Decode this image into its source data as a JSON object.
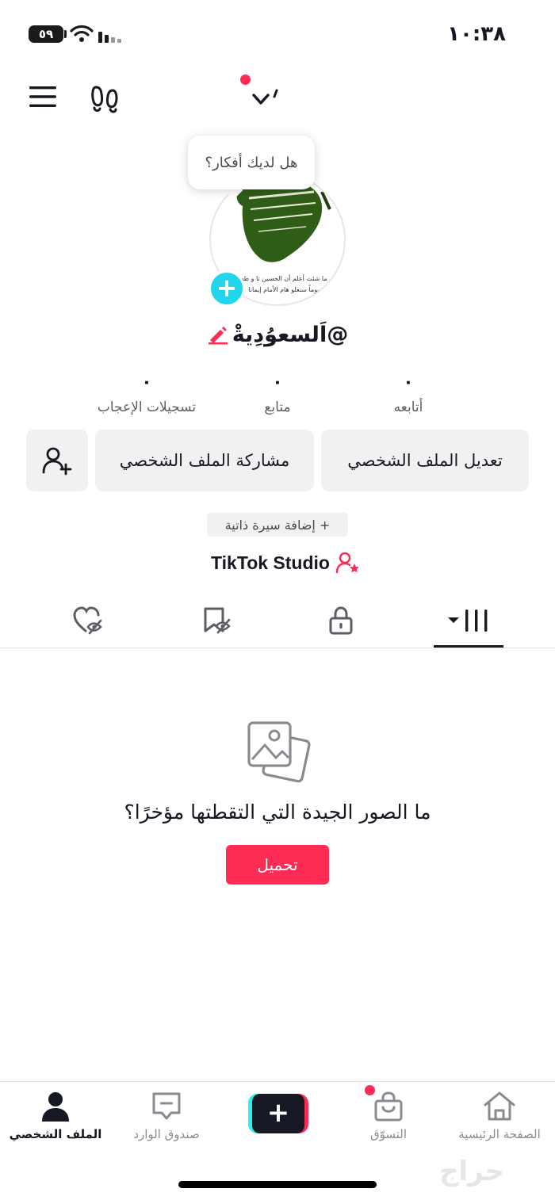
{
  "status_bar": {
    "time": "١٠:٣٨",
    "battery": "٥٩"
  },
  "header": {
    "menu_icon": "hamburger-menu-icon",
    "footprint_icon": "footprints-icon",
    "switch_icon": "chevron-down-icon"
  },
  "profile": {
    "bubble_text": "هل لديك أفكار؟",
    "username": "@اَلسعوُدِيةْ",
    "avatar_caption_line1": "ما شئت أعلم أن الحسين تا و طه",
    "avatar_caption_line2": "يوماً سنعلو هام الأمام إيمانا"
  },
  "stats": [
    {
      "value": "٠",
      "label": "أتابعه"
    },
    {
      "value": "٠",
      "label": "متابع"
    },
    {
      "value": "٠",
      "label": "تسجيلات الإعجاب"
    }
  ],
  "actions": {
    "edit_profile": "تعديل الملف الشخصي",
    "share_profile": "مشاركة الملف الشخصي",
    "add_bio": "+ إضافة سيرة ذاتية",
    "studio": "TikTok Studio"
  },
  "tabs": [
    {
      "name": "videos",
      "icon": "grid-icon",
      "active": true
    },
    {
      "name": "private",
      "icon": "lock-icon"
    },
    {
      "name": "reposts",
      "icon": "bookmark-icon"
    },
    {
      "name": "liked",
      "icon": "heart-icon"
    }
  ],
  "empty_state": {
    "message": "ما الصور الجيدة التي التقطتها مؤخرًا؟",
    "upload_label": "تحميل"
  },
  "bottom_nav": {
    "home": "الصفحة الرئيسية",
    "shop": "التسوّق",
    "create": "+",
    "inbox": "صندوق الوارد",
    "profile": "الملف الشخصي"
  },
  "colors": {
    "accent": "#fe2c55",
    "cyan": "#20d5ec",
    "text": "#161823",
    "muted": "#8a8b91",
    "button_bg": "#f1f1f2"
  },
  "watermark": "حراج"
}
